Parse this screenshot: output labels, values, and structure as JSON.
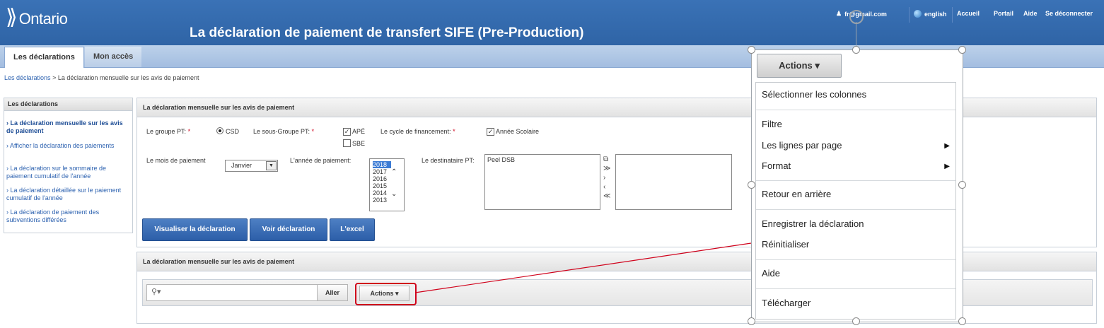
{
  "header": {
    "logo_mark": "⟫",
    "logo_text": "Ontario",
    "title": "La déclaration de paiement de transfert SIFE (Pre-Production)",
    "user_email": "fr@gmail.com",
    "language": "english",
    "links": [
      "Accueil",
      "Portail",
      "Aide",
      "Se déconnecter"
    ]
  },
  "tabs": [
    "Les déclarations",
    "Mon accès"
  ],
  "breadcrumb": {
    "link": "Les déclarations",
    "separator": ">",
    "current": "La déclaration mensuelle sur les avis de paiement"
  },
  "sidebar": {
    "title": "Les déclarations",
    "items": [
      "La déclaration mensuelle sur les avis de paiement",
      "Afficher la déclaration des paiements",
      "La déclaration sur le sommaire de paiement cumulatif de l'année",
      "La déclaration détaillée sur le paiement cumulatif de l'année",
      "La déclaration de paiement des subventions différées"
    ]
  },
  "form_panel": {
    "title": "La déclaration mensuelle sur les avis de paiement",
    "groupe_label": "Le groupe PT:",
    "groupe_value": "CSD",
    "sous_groupe_label": "Le sous-Groupe PT:",
    "sous_groupe_options": [
      {
        "label": "APÉ",
        "checked": true
      },
      {
        "label": "SBE",
        "checked": false
      }
    ],
    "cycle_label": "Le cycle de financement:",
    "cycle_option": "Année Scolaire",
    "mois_label": "Le mois de paiement",
    "mois_value": "Janvier",
    "annee_label": "L'année de paiement:",
    "annees": [
      "2018",
      "2017",
      "2016",
      "2015",
      "2014",
      "2013"
    ],
    "annee_selected": "2018",
    "destinataire_label": "Le destinataire PT:",
    "destinataire_available": [
      "Peel DSB"
    ],
    "buttons": [
      "Visualiser la déclaration",
      "Voir déclaration",
      "L'excel"
    ]
  },
  "results_panel": {
    "title": "La déclaration mensuelle sur les avis de paiement",
    "search_placeholder": "",
    "go_label": "Aller",
    "actions_label": "Actions ▾"
  },
  "actions_menu": {
    "button_label": "Actions ▾",
    "items": [
      "Sélectionner les colonnes",
      "Filtre",
      "Les lignes par page",
      "Format",
      "Retour en arrière",
      "Enregistrer la déclaration",
      "Réinitialiser",
      "Aide",
      "Télécharger"
    ],
    "submenu_items": [
      "Les lignes par page",
      "Format"
    ]
  },
  "colors": {
    "header_blue": "#2f64a6",
    "highlight_red": "#d0021b",
    "button_blue": "#2c5ea8"
  }
}
